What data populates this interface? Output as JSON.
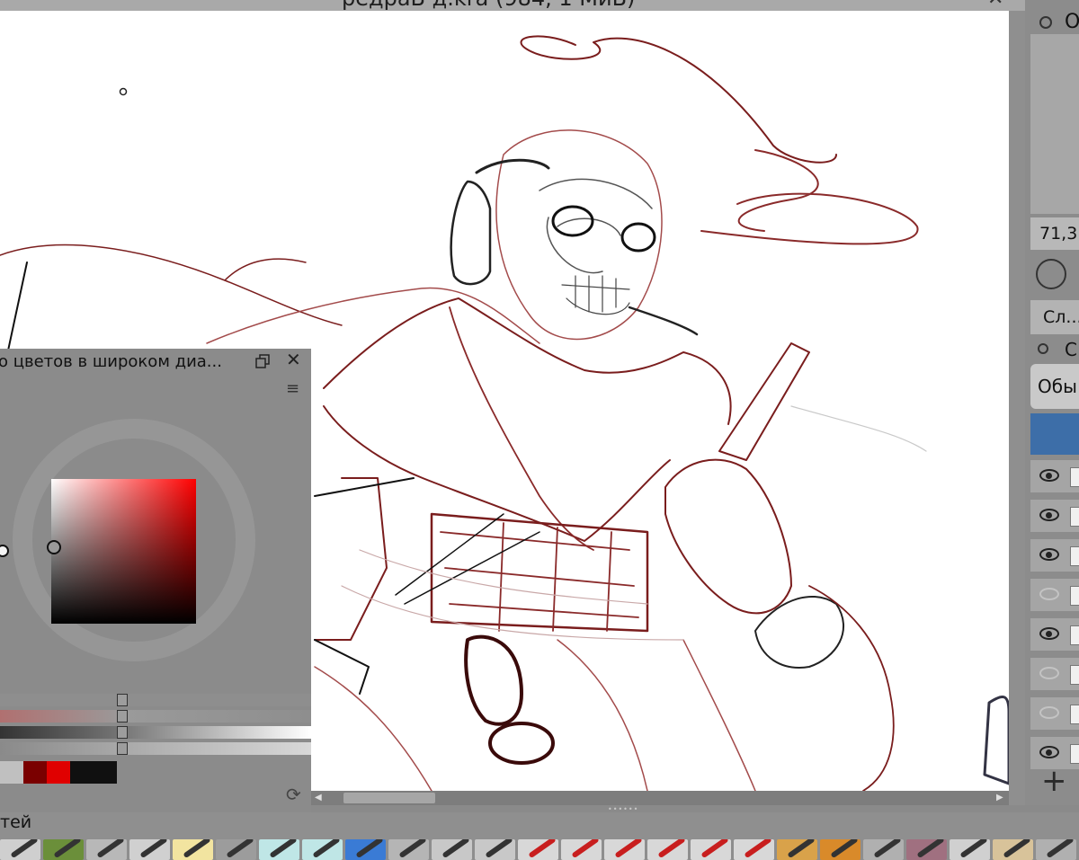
{
  "window": {
    "title": "редраВ д.kra (984, 1 MиБ)",
    "close_glyph": "✕"
  },
  "canvas": {
    "background": "#ffffff",
    "sketch_colors": [
      "#7a1d1d",
      "#a34b4b",
      "#1a1a1a",
      "#c9a8a8"
    ]
  },
  "color_docker": {
    "title": "о цветов в широком диа...",
    "close_glyph": "✕",
    "menu_glyph": "≡",
    "current_hue": "#ff0000",
    "swatches": [
      "#c0c0c0",
      "#7a0000",
      "#e00000",
      "#101010",
      "#101010"
    ],
    "refresh_glyph": "⟳",
    "footer_label": "тей"
  },
  "right_docker": {
    "overview_label": "О",
    "zoom_value": "71,3",
    "layers_tab": "Сл...",
    "layers_lock_label": "С",
    "blend_mode": "Обы",
    "add_layer_glyph": "+",
    "layers": [
      {
        "visible": true
      },
      {
        "visible": true
      },
      {
        "visible": true
      },
      {
        "visible": false
      },
      {
        "visible": true
      },
      {
        "visible": false
      },
      {
        "visible": false
      },
      {
        "visible": true
      }
    ]
  },
  "brush_presets": [
    {
      "icon": "pencil-preset-icon",
      "color": "#cfcfcf"
    },
    {
      "icon": "texture-preset-icon",
      "color": "#6b8f3a"
    },
    {
      "icon": "marker-preset-icon",
      "color": "#b8b8b8"
    },
    {
      "icon": "ink-pen-preset-icon",
      "color": "#d0d0d0"
    },
    {
      "icon": "yellow-pen-preset-icon",
      "color": "#f2e4a0"
    },
    {
      "icon": "charcoal-preset-icon",
      "color": "#9c9c9c"
    },
    {
      "icon": "cyan-brush-preset-icon",
      "color": "#bfe6e6"
    },
    {
      "icon": "cyan-brush-preset-icon",
      "color": "#bfe6e6"
    },
    {
      "icon": "blue-pen-preset-icon",
      "color": "#3a7bd5"
    },
    {
      "icon": "airbrush-preset-icon",
      "color": "#b5b5b5"
    },
    {
      "icon": "blue-brush-preset-icon",
      "color": "#c8c8c8"
    },
    {
      "icon": "multi-brush-preset-icon",
      "color": "#c8c8c8"
    },
    {
      "icon": "red-marker-preset-icon",
      "color": "#d8d8d8"
    },
    {
      "icon": "red-marker-preset-icon",
      "color": "#d8d8d8"
    },
    {
      "icon": "red-marker-preset-icon",
      "color": "#d8d8d8"
    },
    {
      "icon": "red-marker-preset-icon",
      "color": "#d8d8d8"
    },
    {
      "icon": "red-marker-preset-icon",
      "color": "#d8d8d8"
    },
    {
      "icon": "red-marker-preset-icon",
      "color": "#d8d8d8"
    },
    {
      "icon": "paint-preset-icon",
      "color": "#d9a24a"
    },
    {
      "icon": "paint-preset-icon",
      "color": "#d98a2a"
    },
    {
      "icon": "smudge-preset-icon",
      "color": "#b0b0b0"
    },
    {
      "icon": "eraser-preset-icon",
      "color": "#a07080"
    },
    {
      "icon": "ink-pen-preset-icon",
      "color": "#d0d0d0"
    },
    {
      "icon": "brown-brush-preset-icon",
      "color": "#d8c39a"
    },
    {
      "icon": "blender-preset-icon",
      "color": "#b0b0b0"
    }
  ]
}
